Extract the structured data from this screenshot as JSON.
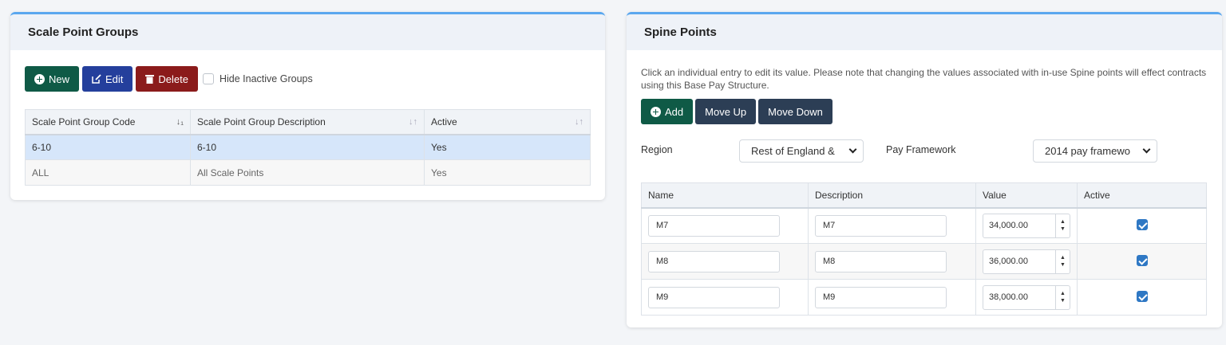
{
  "left_panel": {
    "title": "Scale Point Groups",
    "buttons": {
      "new": "New",
      "edit": "Edit",
      "delete": "Delete"
    },
    "hide_inactive_label": "Hide Inactive Groups",
    "table": {
      "headers": [
        "Scale Point Group Code",
        "Scale Point Group Description",
        "Active"
      ],
      "rows": [
        {
          "code": "6-10",
          "description": "6-10",
          "active": "Yes"
        },
        {
          "code": "ALL",
          "description": "All Scale Points",
          "active": "Yes"
        }
      ]
    }
  },
  "right_panel": {
    "title": "Spine Points",
    "note": "Click an individual entry to edit its value. Please note that changing the values associated with in-use Spine points will effect contracts using this Base Pay Structure.",
    "buttons": {
      "add": "Add",
      "move_up": "Move Up",
      "move_down": "Move Down"
    },
    "region_label": "Region",
    "region_value": "Rest of England &",
    "pay_framework_label": "Pay Framework",
    "pay_framework_value": "2014 pay framewo",
    "table": {
      "headers": [
        "Name",
        "Description",
        "Value",
        "Active"
      ],
      "rows": [
        {
          "name": "M7",
          "description": "M7",
          "value": "34,000.00",
          "active": true
        },
        {
          "name": "M8",
          "description": "M8",
          "value": "36,000.00",
          "active": true
        },
        {
          "name": "M9",
          "description": "M9",
          "value": "38,000.00",
          "active": true
        }
      ]
    }
  },
  "colors": {
    "accent_top": "#5aa7ef",
    "btn_green": "#0f5a46",
    "btn_blue": "#243f9c",
    "btn_red": "#8b1b1b",
    "btn_navy": "#2c3e55",
    "row_selected": "#d6e6fa"
  }
}
